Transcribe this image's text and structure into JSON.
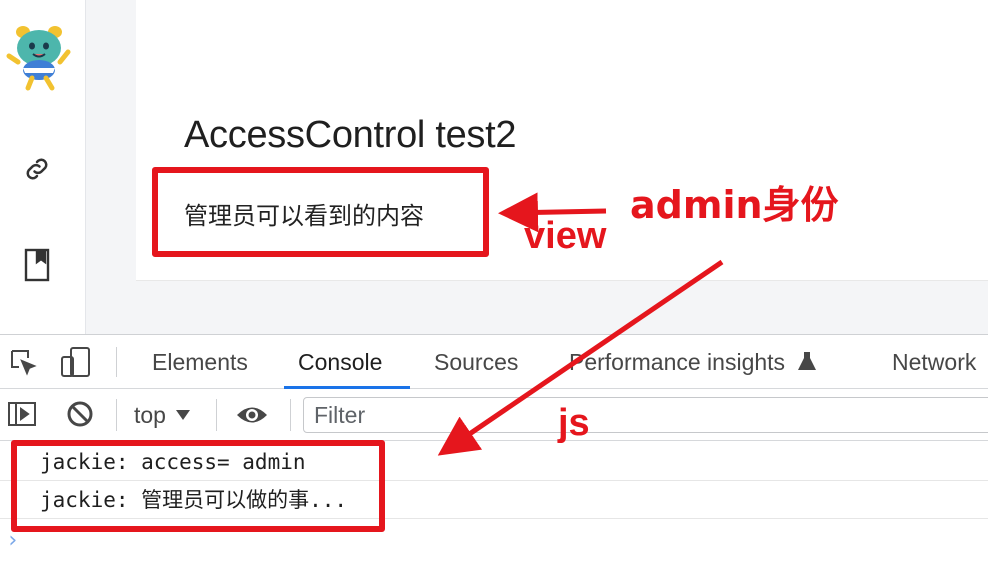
{
  "page": {
    "title": "AccessControl test2",
    "admin_content": "管理员可以看到的内容"
  },
  "sidebar": {
    "items": [
      {
        "icon": "mascot-logo"
      },
      {
        "icon": "link-icon"
      },
      {
        "icon": "bookmark-icon"
      }
    ]
  },
  "devtools": {
    "tabs": [
      {
        "label": "Elements"
      },
      {
        "label": "Console",
        "active": true
      },
      {
        "label": "Sources"
      },
      {
        "label": "Performance insights"
      },
      {
        "label": "Network"
      }
    ],
    "context": "top",
    "filter_placeholder": "Filter",
    "logs": [
      "jackie: access= admin",
      "jackie: 管理员可以做的事..."
    ],
    "prompt": "›"
  },
  "annotations": {
    "admin_identity": "admin身份",
    "view": "view",
    "js": "js"
  },
  "colors": {
    "annotation_red": "#e5161d",
    "active_tab_blue": "#1a73e8"
  }
}
